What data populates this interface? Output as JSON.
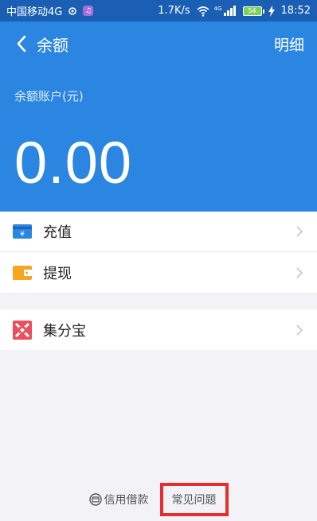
{
  "statusbar": {
    "carrier": "中国移动4G",
    "app_badge": "♫",
    "speed": "1.7K/s",
    "network": "4G",
    "battery": "54",
    "time": "18:52"
  },
  "nav": {
    "title": "余额",
    "detail": "明细"
  },
  "balance": {
    "label": "余额账户(元)",
    "amount": "0.00"
  },
  "section1": [
    {
      "label": "充值",
      "icon": "recharge-icon"
    },
    {
      "label": "提现",
      "icon": "withdraw-icon"
    }
  ],
  "section2": [
    {
      "label": "集分宝",
      "icon": "jifenbao-icon"
    }
  ],
  "footer": {
    "credit_label": "信用借款",
    "faq_label": "常见问题"
  },
  "colors": {
    "header": "#2a86e0",
    "statusbar": "#1a5fb4",
    "recharge": "#2a86e0",
    "withdraw": "#f5a623",
    "jifenbao": "#e94f5d",
    "highlight": "#e62e2e"
  }
}
